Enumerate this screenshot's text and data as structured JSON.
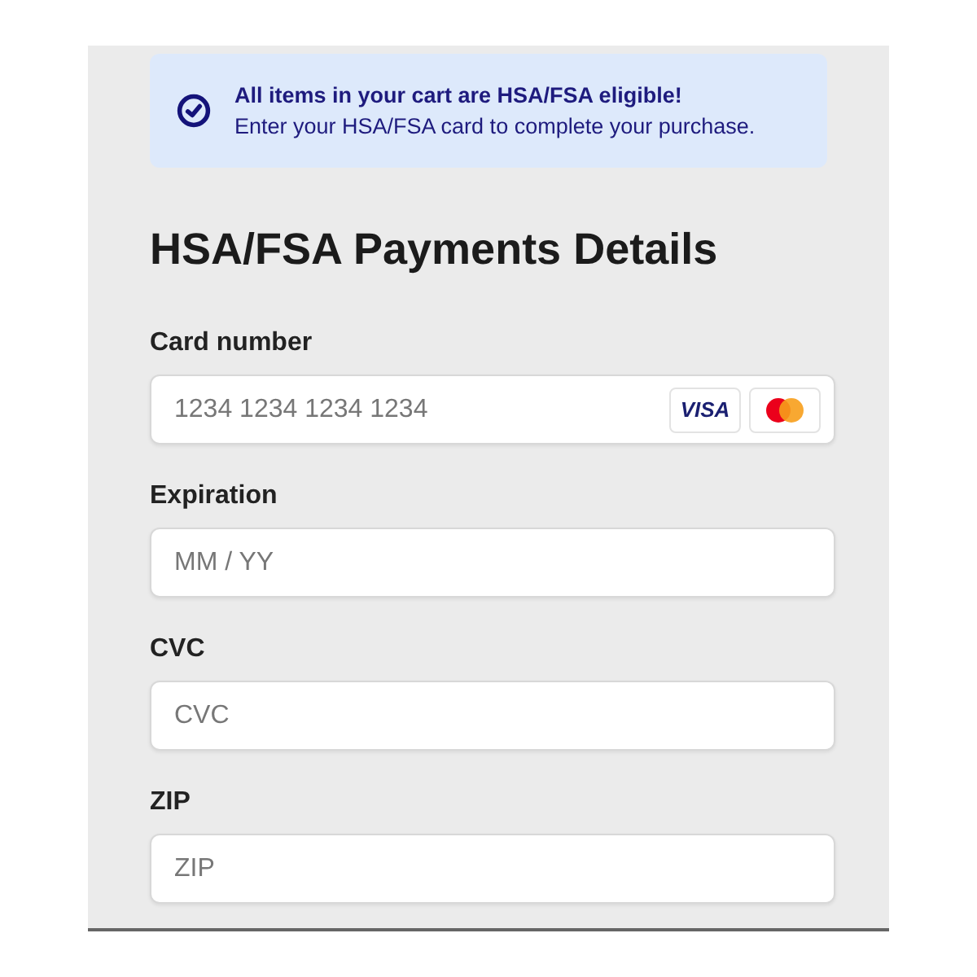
{
  "banner": {
    "title": "All items in your cart are HSA/FSA eligible!",
    "text": "Enter your HSA/FSA card to complete your purchase."
  },
  "heading": "HSA/FSA Payments Details",
  "fields": [
    {
      "label": "Card number",
      "placeholder": "1234 1234 1234 1234",
      "kind": "card",
      "brand_text": "VISA"
    },
    {
      "label": "Expiration",
      "placeholder": "MM / YY",
      "kind": "plain"
    },
    {
      "label": "CVC",
      "placeholder": "CVC",
      "kind": "plain"
    },
    {
      "label": "ZIP",
      "placeholder": "ZIP",
      "kind": "plain"
    }
  ]
}
